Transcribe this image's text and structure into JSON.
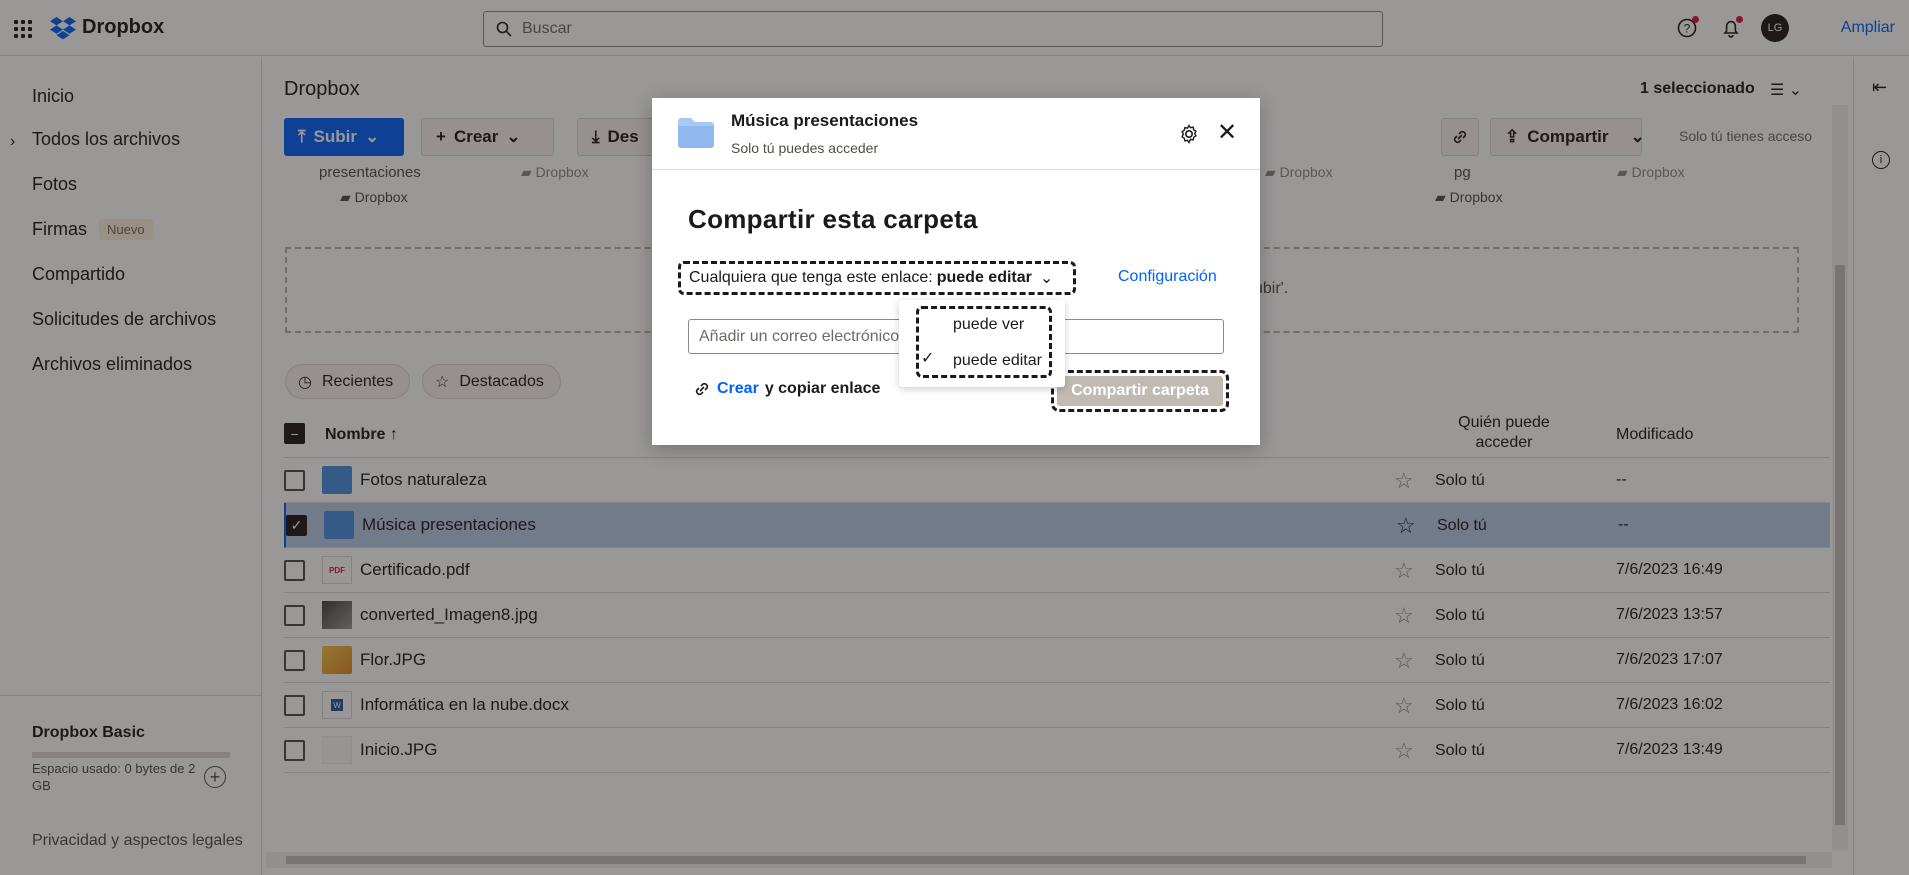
{
  "app": {
    "brand": "Dropbox",
    "search_placeholder": "Buscar",
    "avatar": "LG",
    "upgrade": "Ampliar"
  },
  "sidebar": {
    "items": [
      {
        "label": "Inicio"
      },
      {
        "label": "Todos los archivos"
      },
      {
        "label": "Fotos"
      },
      {
        "label": "Firmas",
        "badge": "Nuevo"
      },
      {
        "label": "Compartido"
      },
      {
        "label": "Solicitudes de archivos"
      },
      {
        "label": "Archivos eliminados"
      }
    ],
    "plan_title": "Dropbox Basic",
    "plan_usage": "Espacio usado: 0 bytes de 2 GB",
    "privacy": "Privacidad y aspectos legales"
  },
  "main": {
    "breadcrumb": "Dropbox",
    "selected_count": "1 seleccionado",
    "upload": "Subir",
    "create": "Crear",
    "download": "Des",
    "share": "Compartir",
    "access": "Solo tú tienes acceso",
    "faded": {
      "a": "presentaciones",
      "b": "Dropbox",
      "c": "Dropbox",
      "d": "Dropbox",
      "e": "pg",
      "f": "Dropbox",
      "g": "Dropbox",
      "h": "Dropbox"
    },
    "drop_text": "ubir'.",
    "chips": {
      "recent": "Recientes",
      "starred": "Destacados"
    },
    "columns": {
      "name": "Nombre",
      "access": "Quién puede acceder",
      "modified": "Modificado"
    },
    "rows": [
      {
        "name": "Fotos naturaleza",
        "access": "Solo tú",
        "modified": "--"
      },
      {
        "name": "Música presentaciones",
        "access": "Solo tú",
        "modified": "--"
      },
      {
        "name": "Certificado.pdf",
        "access": "Solo tú",
        "modified": "7/6/2023 16:49"
      },
      {
        "name": "converted_Imagen8.jpg",
        "access": "Solo tú",
        "modified": "7/6/2023 13:57"
      },
      {
        "name": "Flor.JPG",
        "access": "Solo tú",
        "modified": "7/6/2023 17:07"
      },
      {
        "name": "Informática en la nube.docx",
        "access": "Solo tú",
        "modified": "7/6/2023 16:02"
      },
      {
        "name": "Inicio.JPG",
        "access": "Solo tú",
        "modified": "7/6/2023 13:49"
      }
    ]
  },
  "modal": {
    "folder_name": "Música presentaciones",
    "folder_sub": "Solo tú puedes acceder",
    "heading": "Compartir esta carpeta",
    "perm_prefix": "Cualquiera que tenga este enlace:",
    "perm_value": "puede editar",
    "settings": "Configuración",
    "email_placeholder": "Añadir un correo electrónico",
    "link_create": "Crear",
    "link_rest": "y copiar enlace",
    "share_button": "Compartir carpeta",
    "menu": {
      "view": "puede ver",
      "edit": "puede editar"
    }
  },
  "colors": {
    "accent": "#0061fe",
    "selected_row": "#b7cce8"
  }
}
